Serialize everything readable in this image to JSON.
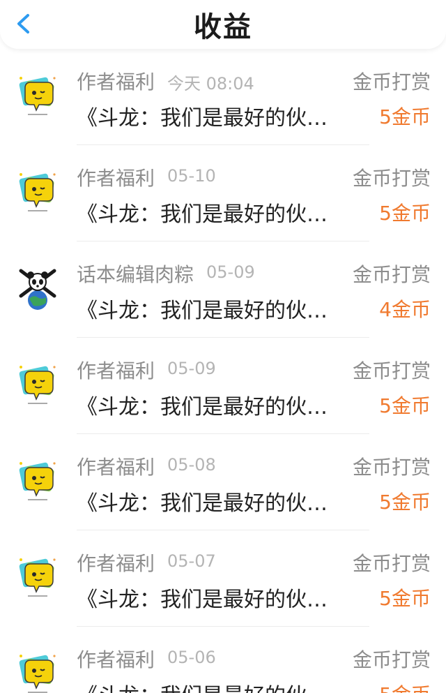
{
  "header": {
    "title": "收益",
    "back_icon": "chevron-left-icon",
    "accent": "#2d9bf0"
  },
  "records": [
    {
      "avatar_icon": "yellow-chat-bubble-icon",
      "name": "作者福利",
      "time": "今天 08:04",
      "work": "《斗龙：我们是最好的伙伴》",
      "type": "金币打赏",
      "amount": "5金币"
    },
    {
      "avatar_icon": "yellow-chat-bubble-icon",
      "name": "作者福利",
      "time": "05-10",
      "work": "《斗龙：我们是最好的伙伴》",
      "type": "金币打赏",
      "amount": "5金币"
    },
    {
      "avatar_icon": "panda-earth-icon",
      "name": "话本编辑肉粽",
      "time": "05-09",
      "work": "《斗龙：我们是最好的伙伴》",
      "type": "金币打赏",
      "amount": "4金币"
    },
    {
      "avatar_icon": "yellow-chat-bubble-icon",
      "name": "作者福利",
      "time": "05-09",
      "work": "《斗龙：我们是最好的伙伴》",
      "type": "金币打赏",
      "amount": "5金币"
    },
    {
      "avatar_icon": "yellow-chat-bubble-icon",
      "name": "作者福利",
      "time": "05-08",
      "work": "《斗龙：我们是最好的伙伴》",
      "type": "金币打赏",
      "amount": "5金币"
    },
    {
      "avatar_icon": "yellow-chat-bubble-icon",
      "name": "作者福利",
      "time": "05-07",
      "work": "《斗龙：我们是最好的伙伴》",
      "type": "金币打赏",
      "amount": "5金币"
    },
    {
      "avatar_icon": "yellow-chat-bubble-icon",
      "name": "作者福利",
      "time": "05-06",
      "work": "《斗龙：我们是最好的伙伴》",
      "type": "金币打赏",
      "amount": "5金币"
    }
  ],
  "colors": {
    "amount": "#f07a2f",
    "secondary_text": "#8d8d8d",
    "time_text": "#b4b4b4",
    "primary_text": "#222222"
  }
}
